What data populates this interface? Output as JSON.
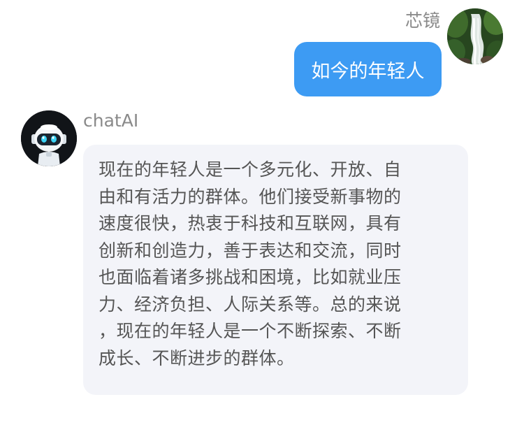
{
  "messages": [
    {
      "role": "user",
      "sender": "芯镜",
      "avatar_icon": "waterfall-avatar-icon",
      "text": "如今的年轻人"
    },
    {
      "role": "assistant",
      "sender": "chatAI",
      "avatar_icon": "robot-avatar-icon",
      "lines": [
        "现在的年轻人是一个多元化、开放、自",
        "由和有活力的群体。他们接受新事物的",
        "速度很快，热衷于科技和互联网，具有",
        "创新和创造力，善于表达和交流，同时",
        "也面临着诸多挑战和困境，比如就业压",
        "力、经济负担、人际关系等。总的来说",
        "，现在的年轻人是一个不断探索、不断",
        "成长、不断进步的群体。"
      ]
    }
  ],
  "colors": {
    "user_bubble": "#3d9bf3",
    "bot_bubble": "#f3f4f9",
    "sender_name": "#8a8a8a",
    "bot_text": "#555555"
  }
}
